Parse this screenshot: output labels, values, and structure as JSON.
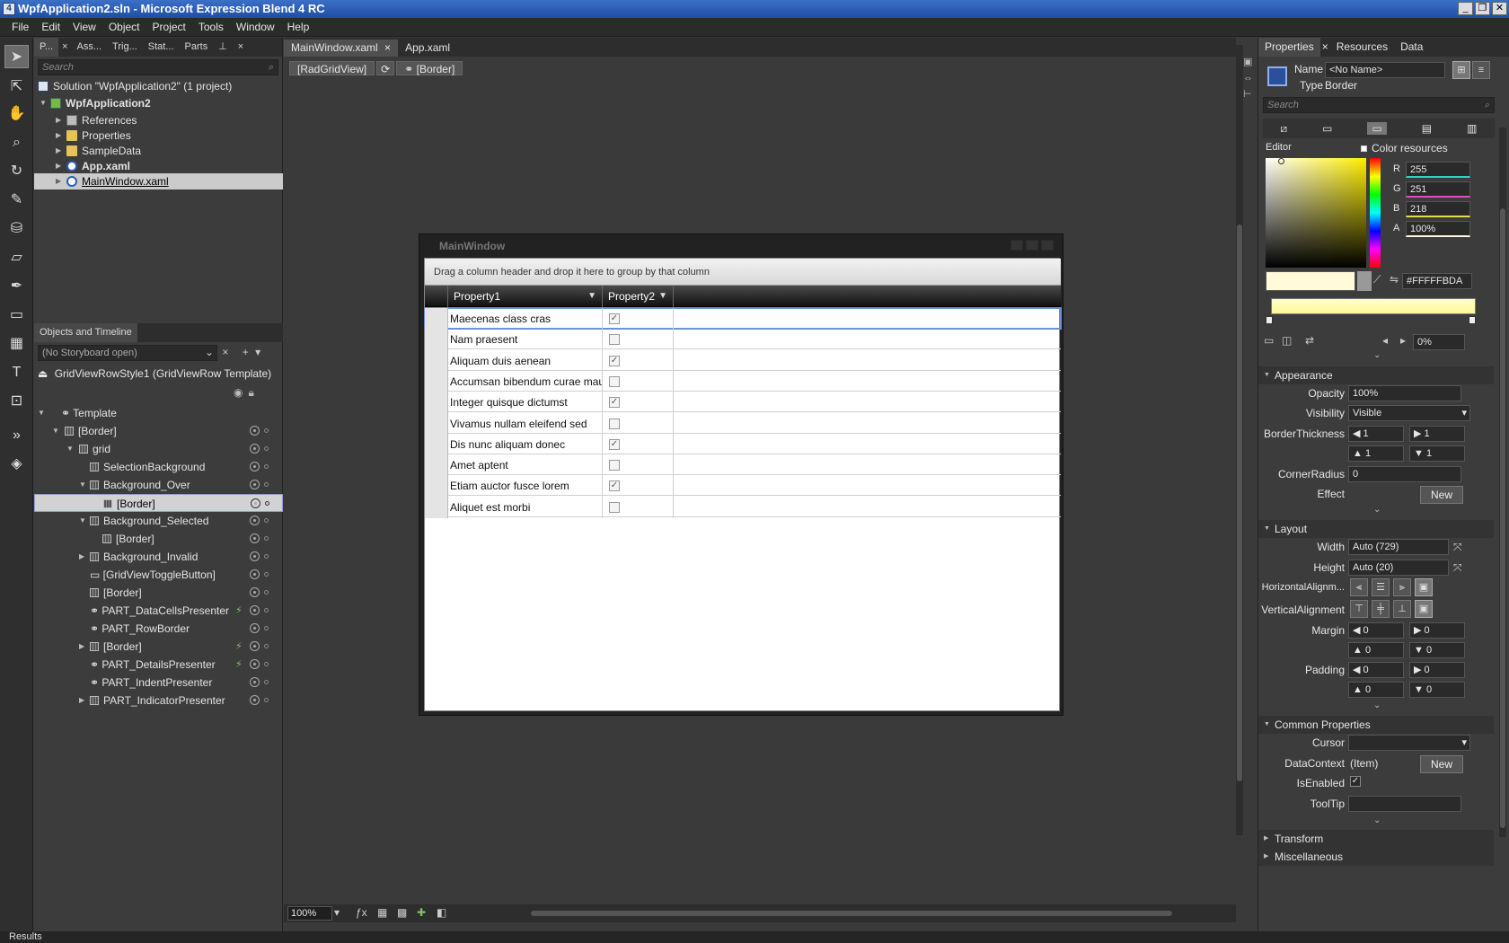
{
  "window": {
    "title": "WpfApplication2.sln - Microsoft Expression Blend 4 RC",
    "app_icon": "4"
  },
  "menu": [
    "File",
    "Edit",
    "View",
    "Object",
    "Project",
    "Tools",
    "Window",
    "Help"
  ],
  "left_tabs": [
    "P...",
    "Ass...",
    "Trig...",
    "Stat...",
    "Parts"
  ],
  "project": {
    "search_placeholder": "Search",
    "items": [
      {
        "label": "Solution \"WpfApplication2\" (1 project)",
        "icon": "solution-icon"
      },
      {
        "label": "WpfApplication2",
        "icon": "project-icon"
      },
      {
        "label": "References",
        "icon": "references-icon"
      },
      {
        "label": "Properties",
        "icon": "folder-icon"
      },
      {
        "label": "SampleData",
        "icon": "folder-icon"
      },
      {
        "label": "App.xaml",
        "icon": "xaml-icon"
      },
      {
        "label": "MainWindow.xaml",
        "icon": "xaml-icon"
      }
    ]
  },
  "objects": {
    "title": "Objects and Timeline",
    "storyboard": "(No Storyboard open)",
    "scope": "GridViewRowStyle1 (GridViewRow Template)",
    "items": [
      {
        "label": "Template"
      },
      {
        "label": "[Border]"
      },
      {
        "label": "grid"
      },
      {
        "label": "SelectionBackground"
      },
      {
        "label": "Background_Over"
      },
      {
        "label": "[Border]"
      },
      {
        "label": "Background_Selected"
      },
      {
        "label": "[Border]"
      },
      {
        "label": "Background_Invalid"
      },
      {
        "label": "[GridViewToggleButton]"
      },
      {
        "label": "[Border]"
      },
      {
        "label": "PART_DataCellsPresenter"
      },
      {
        "label": "PART_RowBorder"
      },
      {
        "label": "[Border]"
      },
      {
        "label": "PART_DetailsPresenter"
      },
      {
        "label": "PART_IndentPresenter"
      },
      {
        "label": "PART_IndicatorPresenter"
      }
    ]
  },
  "doc_tabs": [
    "MainWindow.xaml",
    "App.xaml"
  ],
  "breadcrumb": [
    "[RadGridView]",
    "[Border]"
  ],
  "artboard": {
    "window_title": "MainWindow",
    "group_hint": "Drag a column header and drop it here to group by that column",
    "columns": [
      "Property1",
      "Property2"
    ],
    "rows": [
      {
        "p1": "Maecenas class cras",
        "p2": true
      },
      {
        "p1": "Nam praesent",
        "p2": false
      },
      {
        "p1": "Aliquam duis aenean",
        "p2": true
      },
      {
        "p1": "Accumsan bibendum curae mauris",
        "p2": false
      },
      {
        "p1": "Integer quisque dictumst",
        "p2": true
      },
      {
        "p1": "Vivamus nullam eleifend sed",
        "p2": false
      },
      {
        "p1": "Dis nunc aliquam donec",
        "p2": true
      },
      {
        "p1": "Amet aptent",
        "p2": false
      },
      {
        "p1": "Etiam auctor fusce lorem",
        "p2": true
      },
      {
        "p1": "Aliquet est morbi",
        "p2": false
      }
    ]
  },
  "zoom": "100%",
  "properties": {
    "tabs": [
      "Properties",
      "Resources",
      "Data"
    ],
    "name_label": "Name",
    "name_value": "<No Name>",
    "type_label": "Type",
    "type_value": "Border",
    "search_placeholder": "Search",
    "editor_label": "Editor",
    "color_resources": "Color resources",
    "r_label": "R",
    "r": "255",
    "g_label": "G",
    "g": "251",
    "b_label": "B",
    "b": "218",
    "a_label": "A",
    "a": "100%",
    "hex": "#FFFFFBDA",
    "gradient_offset": "0%",
    "appearance": {
      "title": "Appearance",
      "opacity_label": "Opacity",
      "opacity": "100%",
      "visibility_label": "Visibility",
      "visibility": "Visible",
      "bt_label": "BorderThickness",
      "bt": [
        "1",
        "1",
        "1",
        "1"
      ],
      "cr_label": "CornerRadius",
      "cr": "0",
      "effect_label": "Effect",
      "effect_btn": "New"
    },
    "layout": {
      "title": "Layout",
      "width_label": "Width",
      "width": "Auto (729)",
      "height_label": "Height",
      "height": "Auto (20)",
      "halign_label": "HorizontalAlignm...",
      "valign_label": "VerticalAlignment",
      "margin_label": "Margin",
      "margin": [
        "0",
        "0",
        "0",
        "0"
      ],
      "padding_label": "Padding",
      "padding": [
        "0",
        "0",
        "0",
        "0"
      ]
    },
    "common": {
      "title": "Common Properties",
      "cursor_label": "Cursor",
      "dc_label": "DataContext",
      "dc_value": "(Item)",
      "dc_btn": "New",
      "enabled_label": "IsEnabled",
      "tooltip_label": "ToolTip"
    },
    "transform": "Transform",
    "misc": "Miscellaneous"
  },
  "status": "Results",
  "colors": {
    "selected_color": "#FFFBDA",
    "accent": "#3b70c7"
  }
}
